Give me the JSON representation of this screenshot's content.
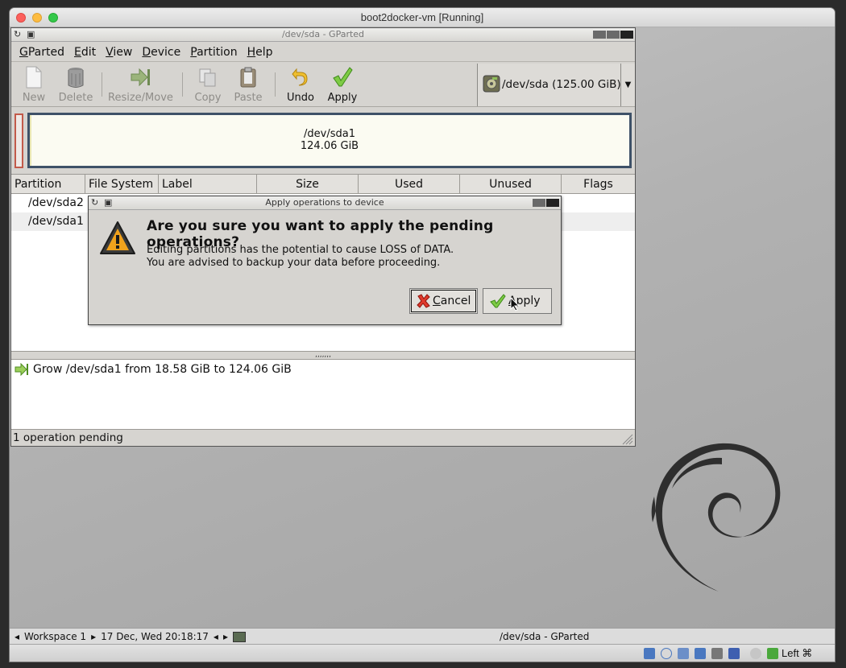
{
  "mac": {
    "title": "boot2docker-vm [Running]",
    "colors": {
      "close": "#fc605c",
      "minimize": "#fdbc40",
      "zoom": "#34c84a"
    }
  },
  "gparted": {
    "title": "/dev/sda - GParted",
    "menu": [
      {
        "mnemonic": "G",
        "rest": "Parted"
      },
      {
        "mnemonic": "E",
        "rest": "dit"
      },
      {
        "mnemonic": "V",
        "rest": "iew"
      },
      {
        "mnemonic": "D",
        "rest": "evice"
      },
      {
        "mnemonic": "P",
        "rest": "artition"
      },
      {
        "mnemonic": "H",
        "rest": "elp"
      }
    ],
    "toolbar": {
      "new": "New",
      "delete": "Delete",
      "resize": "Resize/Move",
      "copy": "Copy",
      "paste": "Paste",
      "undo": "Undo",
      "apply": "Apply"
    },
    "device": "/dev/sda  (125.00 GiB)",
    "visual": {
      "name": "/dev/sda1",
      "size": "124.06 GiB"
    },
    "columns": [
      "Partition",
      "File System",
      "Label",
      "Size",
      "Used",
      "Unused",
      "Flags"
    ],
    "rows": [
      {
        "partition": "/dev/sda2"
      },
      {
        "partition": "/dev/sda1"
      }
    ],
    "operation": "Grow /dev/sda1 from 18.58 GiB to 124.06 GiB",
    "status": "1 operation pending"
  },
  "dialog": {
    "title": "Apply operations to device",
    "heading": "Are you sure you want to apply the pending operations?",
    "line1": "Editing partitions has the potential to cause LOSS of DATA.",
    "line2": "You are advised to backup your data before proceeding.",
    "cancel_mnemonic": "C",
    "cancel_rest": "ancel",
    "apply_mnemonic": "A",
    "apply_rest": "pply"
  },
  "taskbar": {
    "workspace": "Workspace 1",
    "datetime": "17 Dec, Wed 20:18:17",
    "active_task": "/dev/sda - GParted"
  },
  "vbox": {
    "host_key": "Left ⌘"
  }
}
